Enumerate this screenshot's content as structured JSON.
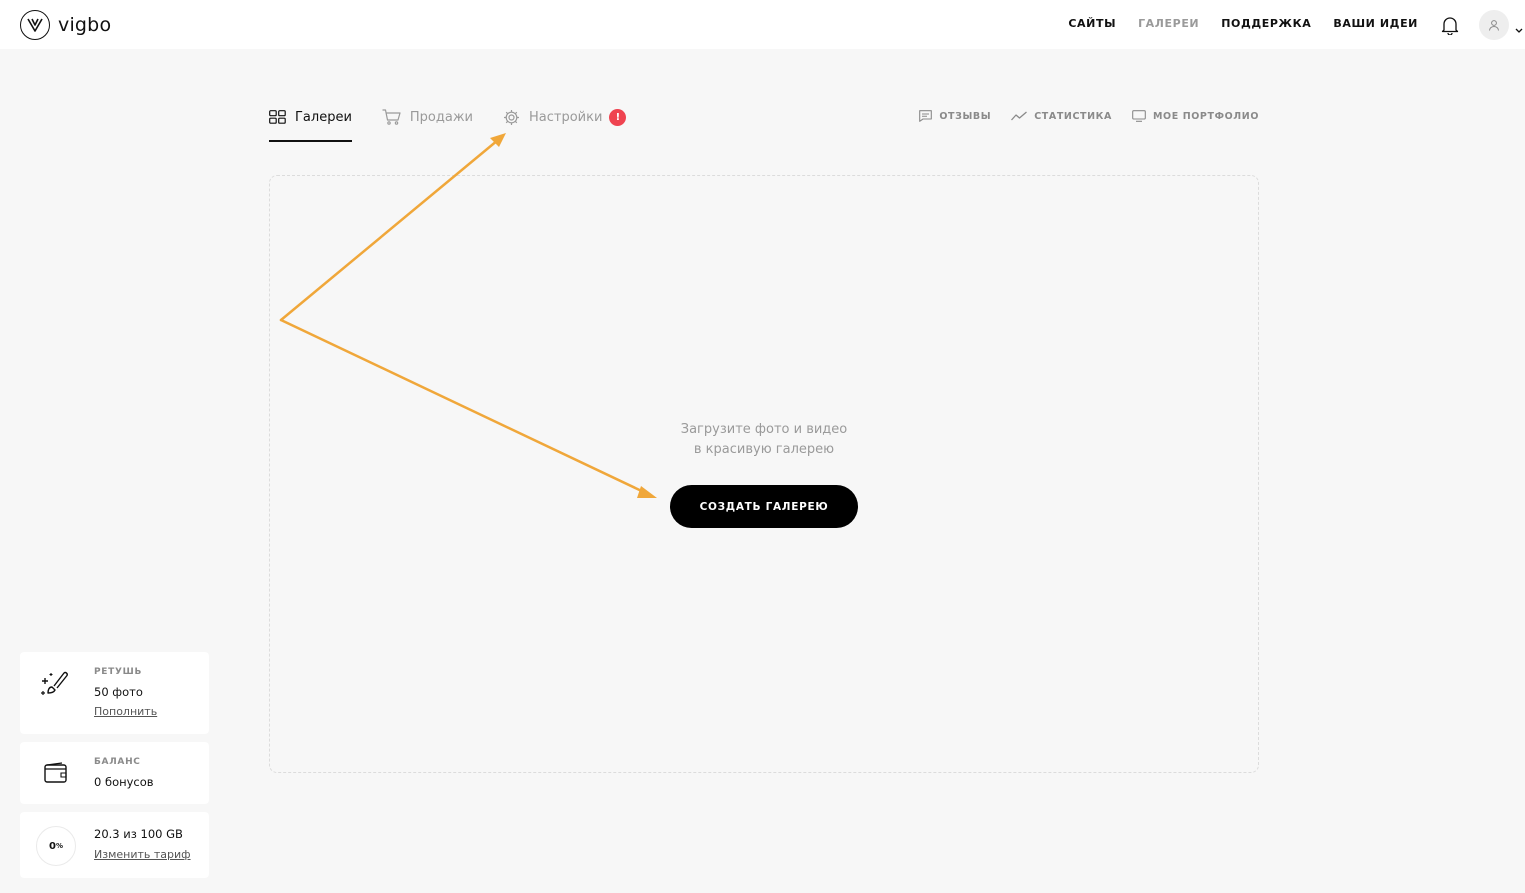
{
  "brand": {
    "name": "vigbo"
  },
  "topnav": [
    {
      "label": "САЙТЫ",
      "muted": false
    },
    {
      "label": "ГАЛЕРЕИ",
      "muted": true
    },
    {
      "label": "ПОДДЕРЖКА",
      "muted": false
    },
    {
      "label": "ВАШИ ИДЕИ",
      "muted": false
    }
  ],
  "tabs": {
    "galleries": "Галереи",
    "sales": "Продажи",
    "settings": "Настройки",
    "settings_badge": "!"
  },
  "right_links": {
    "reviews": "ОТЗЫВЫ",
    "stats": "СТАТИСТИКА",
    "portfolio": "МОЕ ПОРТФОЛИО"
  },
  "empty": {
    "line1": "Загрузите фото и видео",
    "line2": "в красивую галерею",
    "button": "СОЗДАТЬ ГАЛЕРЕЮ"
  },
  "cards": {
    "retouch": {
      "label": "РЕТУШЬ",
      "value": "50 фото",
      "link": "Пополнить"
    },
    "balance": {
      "label": "БАЛАНС",
      "value": "0 бонусов"
    },
    "storage": {
      "percent": "0",
      "percent_sign": "%",
      "value": "20.3 из 100 GB",
      "link": "Изменить тариф"
    }
  },
  "colors": {
    "badge": "#ef4350",
    "annotation": "#f0a73a",
    "button": "#000000"
  }
}
